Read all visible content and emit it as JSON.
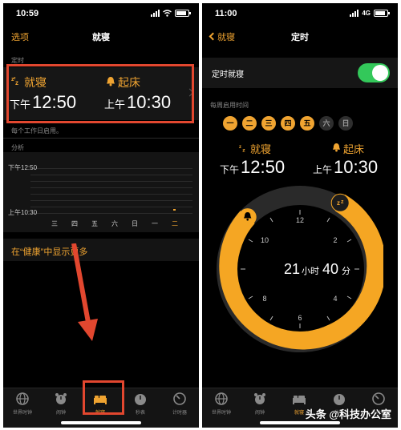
{
  "left": {
    "status_time": "10:59",
    "nav_left": "选项",
    "nav_title": "就寝",
    "schedule_section": "定时",
    "bedtime_label": "就寝",
    "bedtime_ampm": "下午",
    "bedtime_time": "12:50",
    "wake_label": "起床",
    "wake_ampm": "上午",
    "wake_time": "10:30",
    "repeat_note": "每个工作日启用。",
    "analysis_section": "分析",
    "chart_top_label": "下午12:50",
    "chart_bottom_label": "上午10:30",
    "days": [
      "三",
      "四",
      "五",
      "六",
      "日",
      "一",
      "二"
    ],
    "health_link": "在“健康”中显示更多",
    "tabs": [
      "世界时钟",
      "闹钟",
      "就寝",
      "秒表",
      "计时器"
    ]
  },
  "right": {
    "status_time": "11:00",
    "network": "4G",
    "nav_back": "就寝",
    "nav_title": "定时",
    "toggle_label": "定时就寝",
    "toggle_on": true,
    "weekly_section": "每周启用时间",
    "days": [
      "一",
      "二",
      "三",
      "四",
      "五",
      "六",
      "日"
    ],
    "days_enabled": [
      true,
      true,
      true,
      true,
      true,
      false,
      false
    ],
    "bedtime_label": "就寝",
    "bedtime_ampm": "下午",
    "bedtime_time": "12:50",
    "wake_label": "起床",
    "wake_ampm": "上午",
    "wake_time": "10:30",
    "clock_numbers": [
      "12",
      "2",
      "4",
      "6",
      "8",
      "10"
    ],
    "duration_hours": "21",
    "duration_hours_unit": "小时",
    "duration_minutes": "40",
    "duration_minutes_unit": "分",
    "tabs": [
      "世界时钟",
      "闹钟",
      "就寝",
      "秒表",
      "计时器"
    ]
  },
  "watermark": "头条 @科技办公室",
  "colors": {
    "accent": "#f0a431",
    "highlight": "#e2472f",
    "toggle": "#33c85a"
  }
}
